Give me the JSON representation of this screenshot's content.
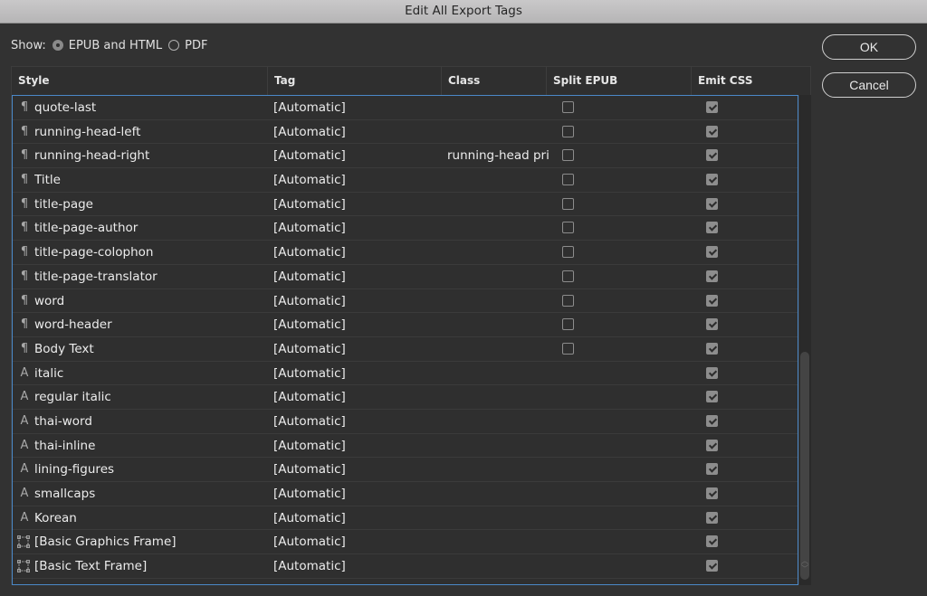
{
  "window": {
    "title": "Edit All Export Tags"
  },
  "show": {
    "label": "Show:",
    "options": [
      {
        "label": "EPUB and HTML",
        "selected": true
      },
      {
        "label": "PDF",
        "selected": false
      }
    ]
  },
  "buttons": {
    "ok": "OK",
    "cancel": "Cancel"
  },
  "table": {
    "columns": [
      "Style",
      "Tag",
      "Class",
      "Split EPUB",
      "Emit CSS"
    ],
    "rows": [
      {
        "icon": "paragraph-style-icon",
        "style": "quote-last",
        "tag": "[Automatic]",
        "class": "",
        "split": false,
        "split_visible": true,
        "emit": true
      },
      {
        "icon": "paragraph-style-icon",
        "style": "running-head-left",
        "tag": "[Automatic]",
        "class": "",
        "split": false,
        "split_visible": true,
        "emit": true
      },
      {
        "icon": "paragraph-style-icon",
        "style": "running-head-right",
        "tag": "[Automatic]",
        "class": "running-head pri",
        "split": false,
        "split_visible": true,
        "emit": true
      },
      {
        "icon": "paragraph-style-icon",
        "style": "Title",
        "tag": "[Automatic]",
        "class": "",
        "split": false,
        "split_visible": true,
        "emit": true
      },
      {
        "icon": "paragraph-style-icon",
        "style": "title-page",
        "tag": "[Automatic]",
        "class": "",
        "split": false,
        "split_visible": true,
        "emit": true
      },
      {
        "icon": "paragraph-style-icon",
        "style": "title-page-author",
        "tag": "[Automatic]",
        "class": "",
        "split": false,
        "split_visible": true,
        "emit": true
      },
      {
        "icon": "paragraph-style-icon",
        "style": "title-page-colophon",
        "tag": "[Automatic]",
        "class": "",
        "split": false,
        "split_visible": true,
        "emit": true
      },
      {
        "icon": "paragraph-style-icon",
        "style": "title-page-translator",
        "tag": "[Automatic]",
        "class": "",
        "split": false,
        "split_visible": true,
        "emit": true
      },
      {
        "icon": "paragraph-style-icon",
        "style": "word",
        "tag": "[Automatic]",
        "class": "",
        "split": false,
        "split_visible": true,
        "emit": true
      },
      {
        "icon": "paragraph-style-icon",
        "style": "word-header",
        "tag": "[Automatic]",
        "class": "",
        "split": false,
        "split_visible": true,
        "emit": true
      },
      {
        "icon": "paragraph-style-icon",
        "style": "Body Text",
        "tag": "[Automatic]",
        "class": "",
        "split": false,
        "split_visible": true,
        "emit": true
      },
      {
        "icon": "character-style-icon",
        "style": "italic",
        "tag": "[Automatic]",
        "class": "",
        "split": false,
        "split_visible": false,
        "emit": true
      },
      {
        "icon": "character-style-icon",
        "style": "regular italic",
        "tag": "[Automatic]",
        "class": "",
        "split": false,
        "split_visible": false,
        "emit": true
      },
      {
        "icon": "character-style-icon",
        "style": "thai-word",
        "tag": "[Automatic]",
        "class": "",
        "split": false,
        "split_visible": false,
        "emit": true
      },
      {
        "icon": "character-style-icon",
        "style": "thai-inline",
        "tag": "[Automatic]",
        "class": "",
        "split": false,
        "split_visible": false,
        "emit": true
      },
      {
        "icon": "character-style-icon",
        "style": "lining-figures",
        "tag": "[Automatic]",
        "class": "",
        "split": false,
        "split_visible": false,
        "emit": true
      },
      {
        "icon": "character-style-icon",
        "style": "smallcaps",
        "tag": "[Automatic]",
        "class": "",
        "split": false,
        "split_visible": false,
        "emit": true
      },
      {
        "icon": "character-style-icon",
        "style": "Korean",
        "tag": "[Automatic]",
        "class": "",
        "split": false,
        "split_visible": false,
        "emit": true
      },
      {
        "icon": "object-style-icon",
        "style": "[Basic Graphics Frame]",
        "tag": "[Automatic]",
        "class": "",
        "split": false,
        "split_visible": false,
        "emit": true
      },
      {
        "icon": "object-style-icon",
        "style": "[Basic Text Frame]",
        "tag": "[Automatic]",
        "class": "",
        "split": false,
        "split_visible": false,
        "emit": true
      }
    ]
  },
  "icons": {
    "paragraph-style-icon": "¶",
    "character-style-icon": "A"
  },
  "colors": {
    "selection_border": "#4b88c8",
    "background": "#323232"
  }
}
